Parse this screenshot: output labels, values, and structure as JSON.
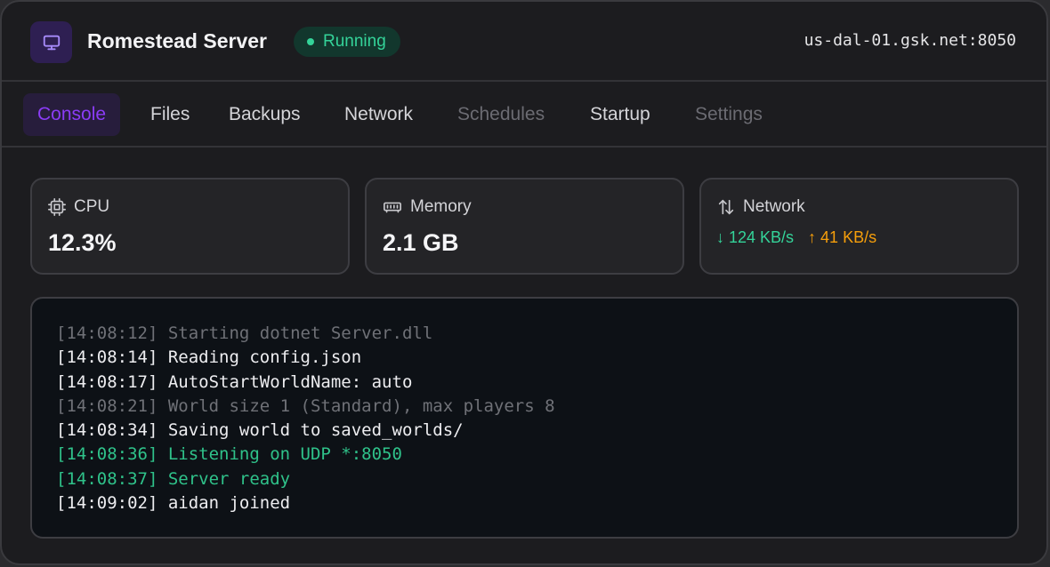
{
  "header": {
    "title": "Romestead Server",
    "status": "Running",
    "host": "us-dal-01.gsk.net:8050",
    "icon": "monitor-icon"
  },
  "tabs": [
    {
      "label": "Console",
      "state": "active"
    },
    {
      "label": "Files",
      "state": "normal"
    },
    {
      "label": "Backups",
      "state": "normal"
    },
    {
      "label": "Network",
      "state": "normal"
    },
    {
      "label": "Schedules",
      "state": "disabled"
    },
    {
      "label": "Startup",
      "state": "normal"
    },
    {
      "label": "Settings",
      "state": "disabled"
    }
  ],
  "stats": {
    "cpu": {
      "label": "CPU",
      "value": "12.3%",
      "icon": "cpu-icon"
    },
    "memory": {
      "label": "Memory",
      "value": "2.1 GB",
      "icon": "memory-icon"
    },
    "network": {
      "label": "Network",
      "down": "↓ 124 KB/s",
      "up": "↑ 41 KB/s",
      "icon": "transfer-arrows-icon"
    }
  },
  "console": {
    "lines": [
      {
        "time": "[14:08:12]",
        "text": "Starting dotnet Server.dll",
        "level": "dim"
      },
      {
        "time": "[14:08:14]",
        "text": "Reading config.json",
        "level": "info"
      },
      {
        "time": "[14:08:17]",
        "text": "AutoStartWorldName: auto",
        "level": "info"
      },
      {
        "time": "[14:08:21]",
        "text": "World size 1 (Standard), max players 8",
        "level": "dim"
      },
      {
        "time": "[14:08:34]",
        "text": "Saving world to saved_worlds/",
        "level": "info"
      },
      {
        "time": "[14:08:36]",
        "text": "Listening on UDP *:8050",
        "level": "ok"
      },
      {
        "time": "[14:08:37]",
        "text": "Server ready",
        "level": "ok"
      },
      {
        "time": "[14:09:02]",
        "text": "aidan joined",
        "level": "info"
      }
    ]
  },
  "colors": {
    "accent": "#8b3cf6",
    "success": "#34d399",
    "warning": "#f59e0b",
    "background": "#1c1c1f"
  }
}
